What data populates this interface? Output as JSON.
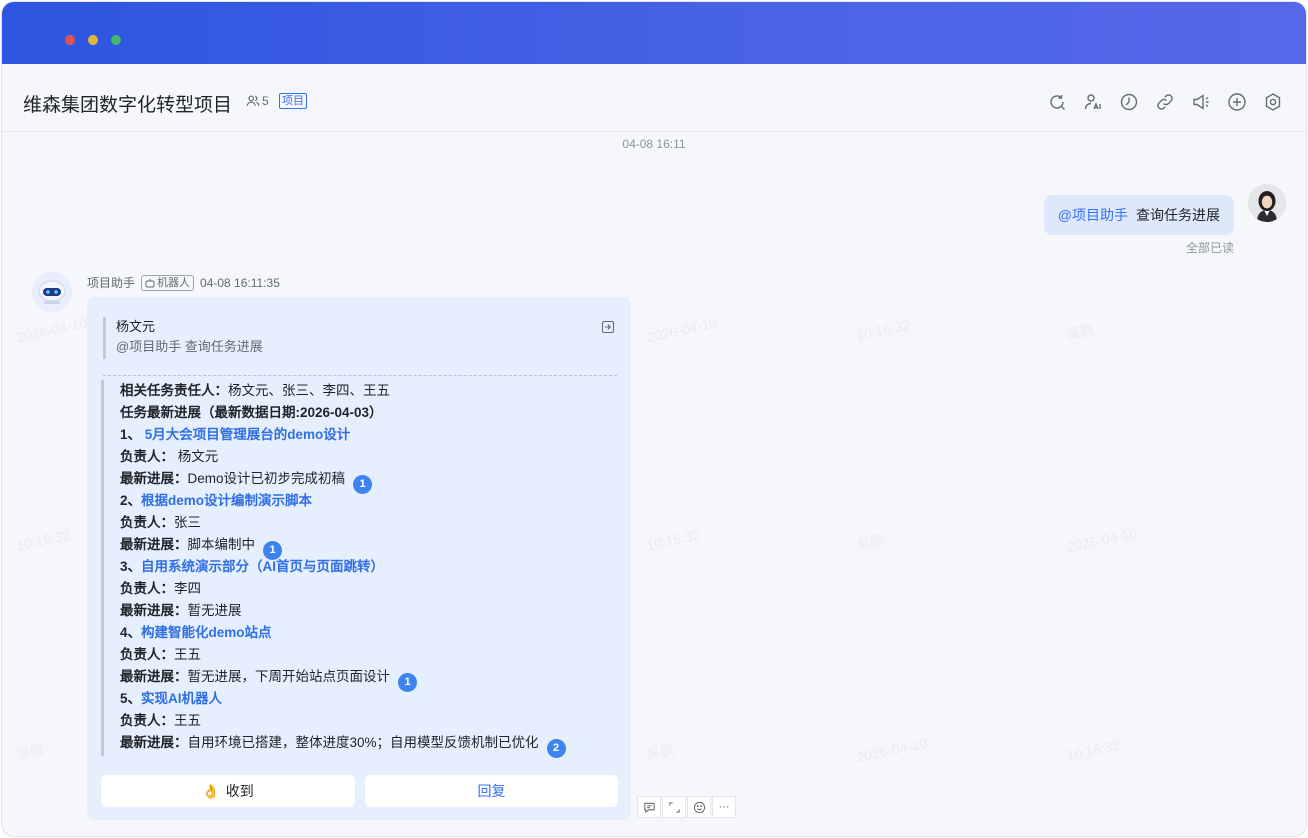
{
  "chat": {
    "title": "维森集团数字化转型项目",
    "member_count": "5",
    "tag": "项目"
  },
  "watermark": {
    "name": "吴鹏",
    "date": "2026-04-10",
    "time": "10:16:32"
  },
  "conversation": {
    "time_divider": "04-08 16:11",
    "outgoing": {
      "mention": "@项目助手",
      "text": "查询任务进展",
      "read_status": "全部已读"
    },
    "bot": {
      "name": "项目助手",
      "tag": "机器人",
      "time": "04-08 16:11:35",
      "quote": {
        "name": "杨文元",
        "text": "@项目助手 查询任务进展"
      },
      "lines": [
        {
          "label": "相关任务责任人：",
          "text": "杨文元、张三、李四、王五"
        },
        {
          "label": "任务最新进展（最新数据日期:2026-04-03）"
        },
        {
          "prefix": "1、 ",
          "link": "5月大会项目管理展台的demo设计"
        },
        {
          "label": "负责人：",
          "text": " 杨文元"
        },
        {
          "label": "最新进展：",
          "text": "Demo设计已初步完成初稿",
          "badge": "1"
        },
        {
          "prefix": "2、",
          "link": "根据demo设计编制演示脚本"
        },
        {
          "label": "负责人：",
          "text": "张三"
        },
        {
          "label": "最新进展：",
          "text": "脚本编制中",
          "badge": "1"
        },
        {
          "prefix": "3、",
          "link": "自用系统演示部分（AI首页与页面跳转）"
        },
        {
          "label": "负责人：",
          "text": "李四"
        },
        {
          "label": "最新进展：",
          "text": "暂无进展"
        },
        {
          "prefix": "4、",
          "link": "构建智能化demo站点"
        },
        {
          "label": "负责人：",
          "text": "王五"
        },
        {
          "label": "最新进展：",
          "text": "暂无进展，下周开始站点页面设计",
          "badge": "1"
        },
        {
          "prefix": "5、",
          "link": "实现AI机器人"
        },
        {
          "label": "负责人：",
          "text": "王五"
        },
        {
          "label": "最新进展：",
          "text": "自用环境已搭建，整体进度30%；自用模型反馈机制已优化",
          "badge": "2"
        }
      ],
      "buttons": {
        "ack_emoji": "👌",
        "ack": "收到",
        "reply": "回复"
      }
    },
    "message_actions": [
      "comment-icon",
      "expand-icon",
      "emoji-icon",
      "more-icon"
    ],
    "more_glyph": "···"
  },
  "colors": {
    "titlebar_start": "#2d55e0",
    "titlebar_end": "#5668ea",
    "accent": "#3370ff",
    "card_bg": "#e6effd",
    "badge": "#3e84f0"
  }
}
